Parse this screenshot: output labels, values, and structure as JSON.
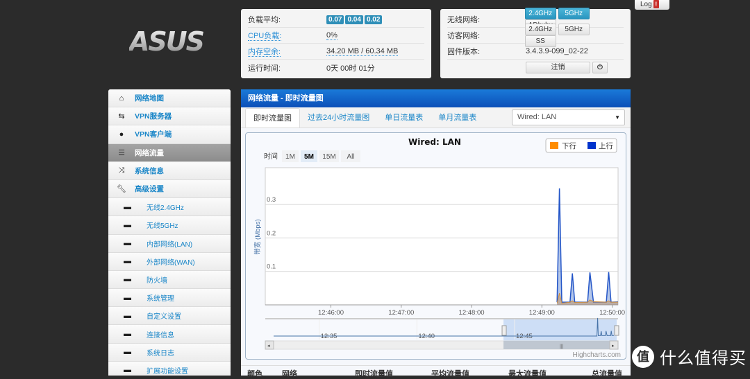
{
  "logo": {
    "text": "ASUS"
  },
  "log_button": {
    "label": "Log",
    "alert": "!"
  },
  "system_status": {
    "load_avg": {
      "label": "负载平均:",
      "values": [
        "0.07",
        "0.04",
        "0.02"
      ]
    },
    "cpu": {
      "label": "CPU负载:",
      "value": "0%"
    },
    "memory": {
      "label": "内存空余:",
      "value": "34.20 MB / 60.34 MB"
    },
    "uptime": {
      "label": "运行时间:",
      "value": "0天 00时 01分"
    }
  },
  "network_status": {
    "wireless": {
      "label": "无线网络:",
      "buttons": [
        "2.4GHz",
        "5GHz",
        "ADbyby"
      ]
    },
    "guest": {
      "label": "访客网络:",
      "buttons": [
        "2.4GHz",
        "5GHz",
        "SS"
      ]
    },
    "firmware": {
      "label": "固件版本:",
      "value": "3.4.3.9-099_02-22"
    },
    "logout_label": "注销",
    "power_icon": "power-icon"
  },
  "sidebar": {
    "items": [
      {
        "label": "网络地图",
        "icon": "home-icon"
      },
      {
        "label": "VPN服务器",
        "icon": "retweet-icon"
      },
      {
        "label": "VPN客户端",
        "icon": "globe-icon"
      },
      {
        "label": "网络流量",
        "icon": "list-icon",
        "selected": true
      },
      {
        "label": "系统信息",
        "icon": "shuffle-icon"
      },
      {
        "label": "高级设置",
        "icon": "wrench-icon"
      }
    ],
    "sub_items": [
      {
        "label": "无线2.4GHz"
      },
      {
        "label": "无线5GHz"
      },
      {
        "label": "内部网络(LAN)"
      },
      {
        "label": "外部网络(WAN)"
      },
      {
        "label": "防火墙"
      },
      {
        "label": "系统管理"
      },
      {
        "label": "自定义设置"
      },
      {
        "label": "连接信息"
      },
      {
        "label": "系统日志"
      },
      {
        "label": "扩展功能设置"
      }
    ]
  },
  "main": {
    "title": "网络流量 - 即时流量图",
    "tabs": [
      "即时流量图",
      "过去24小时流量图",
      "单日流量表",
      "单月流量表"
    ],
    "interface_select": {
      "value": "Wired: LAN"
    },
    "range_label": "时间",
    "range_buttons": [
      "1M",
      "5M",
      "15M",
      "All"
    ],
    "range_selected": "5M",
    "credit": "Highcharts.com",
    "table_headers": [
      "颜色",
      "网络",
      "即时流量值",
      "平均流量值",
      "最大流量值",
      "总流量值"
    ]
  },
  "chart_data": {
    "type": "area",
    "title": "Wired: LAN",
    "xlabel": "",
    "ylabel": "带宽 (Mbps)",
    "x_ticks": [
      "12:46:00",
      "12:47:00",
      "12:48:00",
      "12:49:00",
      "12:50:00"
    ],
    "y_ticks": [
      "0.1",
      "0.2",
      "0.3"
    ],
    "xlim": [
      "12:45:04",
      "12:50:05"
    ],
    "ylim": [
      0,
      0.41
    ],
    "grid": true,
    "legend_position": "top-right",
    "series": [
      {
        "name": "下行",
        "color": "#ff8c00",
        "x": [
          "12:49:13",
          "12:49:15",
          "12:49:17",
          "12:49:24",
          "12:49:26",
          "12:49:28",
          "12:49:39",
          "12:49:41",
          "12:49:44",
          "12:49:55",
          "12:49:57",
          "12:49:59",
          "12:50:05"
        ],
        "values": [
          0.005,
          0.035,
          0.005,
          0.008,
          0.012,
          0.007,
          0.008,
          0.015,
          0.01,
          0.008,
          0.012,
          0.008,
          0.008
        ]
      },
      {
        "name": "上行",
        "color": "#0033cc",
        "x": [
          "12:49:13",
          "12:49:15",
          "12:49:17",
          "12:49:24",
          "12:49:26",
          "12:49:28",
          "12:49:39",
          "12:49:41",
          "12:49:44",
          "12:49:55",
          "12:49:57",
          "12:49:59",
          "12:50:05"
        ],
        "values": [
          0.008,
          0.348,
          0.008,
          0.008,
          0.094,
          0.008,
          0.008,
          0.097,
          0.008,
          0.008,
          0.098,
          0.008,
          0.009
        ]
      }
    ],
    "navigator": {
      "x_ticks": [
        "12:35",
        "12:40",
        "12:45"
      ],
      "selected_range": [
        "12:45:04",
        "12:50:05"
      ]
    }
  },
  "watermark": {
    "icon_char": "值",
    "text": "什么值得买"
  }
}
